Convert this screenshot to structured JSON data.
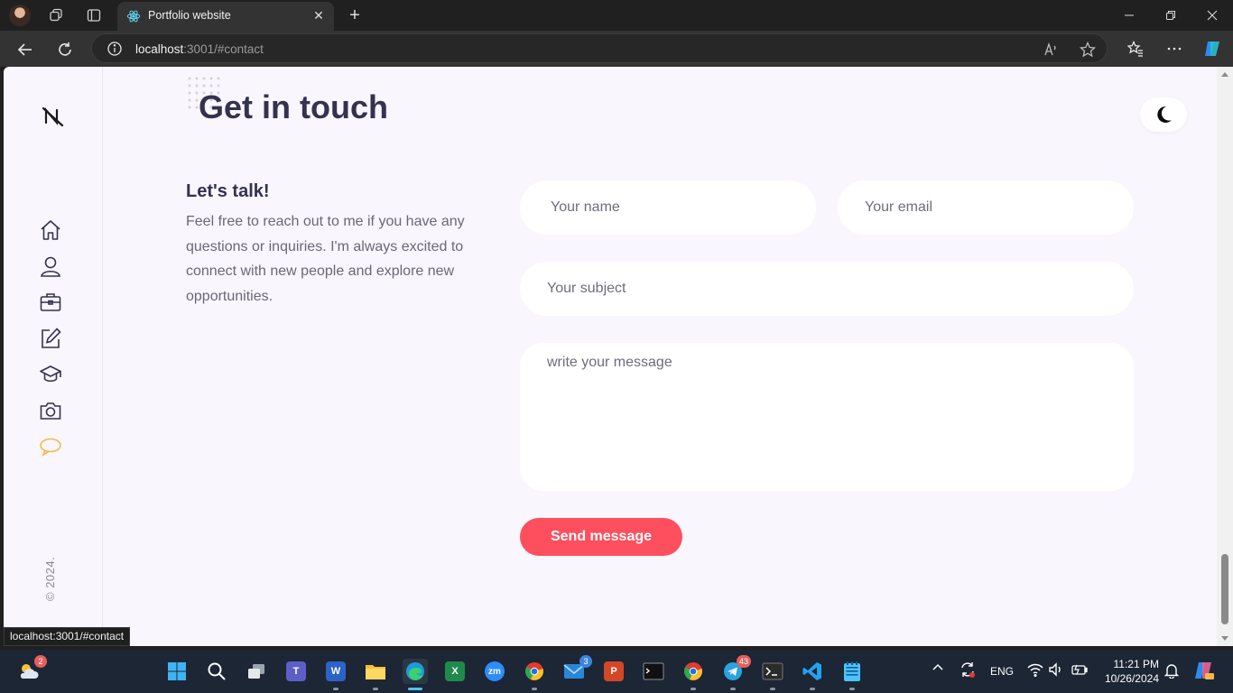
{
  "browser": {
    "tab_title": "Portfolio website",
    "tab_close": "✕",
    "new_tab": "+",
    "url_host": "localhost",
    "url_rest": ":3001/#contact",
    "status_url": "localhost:3001/#contact"
  },
  "page": {
    "heading": "Get in touch",
    "talk_title": "Let's talk!",
    "talk_text": "Feel free to reach out to me if you have any questions or inquiries. I'm always excited to connect with new people and explore new opportunities.",
    "form": {
      "name_placeholder": "Your name",
      "email_placeholder": "Your email",
      "subject_placeholder": "Your subject",
      "message_placeholder": "write your message",
      "send_label": "Send message"
    },
    "copyright": "© 2024.",
    "sidebar_items": [
      "home",
      "about",
      "portfolio",
      "blog",
      "education",
      "gallery",
      "contact"
    ],
    "active_item": "contact",
    "accent_color": "#fd4f5e",
    "active_icon_color": "#f5b94a"
  },
  "taskbar": {
    "weather_badge": "2",
    "mail_badge": "3",
    "telegram_badge": "43",
    "language": "ENG",
    "time": "11:21 PM",
    "date": "10/26/2024"
  }
}
